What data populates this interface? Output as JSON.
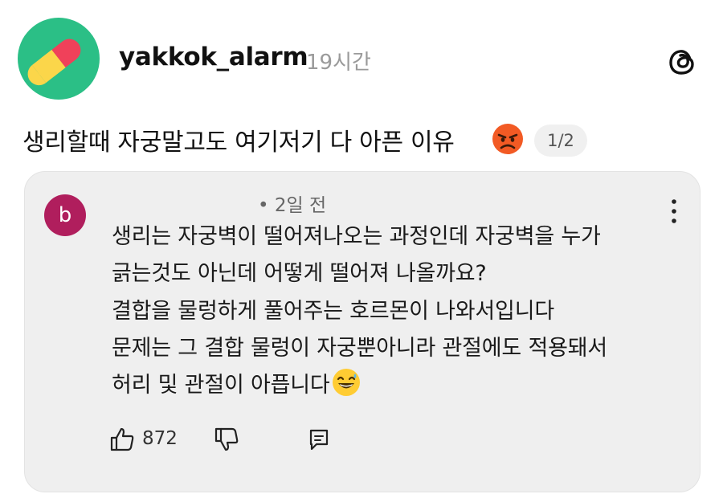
{
  "post": {
    "username": "yakkok_alarm",
    "time": "19시간",
    "caption": "생리할때 자궁말고도 여기저기 다 아픈 이유",
    "caption_emoji": "angry-face-emoji",
    "page_indicator": "1/2"
  },
  "comment": {
    "avatar_letter": "b",
    "time": "• 2일 전",
    "lines": [
      "생리는 자궁벽이 떨어져나오는 과정인데 자궁벽을 누가",
      "긁는것도 아닌데 어떻게 떨어져 나올까요?",
      "결합을 물렁하게 풀어주는 호르몬이 나와서입니다",
      "문제는 그 결합 물렁이 자궁뿐아니라 관절에도 적용돼서",
      "허리 및 관절이 아픕니다"
    ],
    "like_count": "872"
  },
  "icons": {
    "avatar": "pill-icon",
    "threads": "threads-logo-icon",
    "more": "more-vertical-icon",
    "like": "thumbs-up-icon",
    "dislike": "thumbs-down-icon",
    "reply": "reply-icon",
    "trailing_emoji": "grinning-sweat-emoji"
  },
  "colors": {
    "avatar_bg": "#2bbf86",
    "comment_avatar_bg": "#b01e5d",
    "card_bg": "#efefef",
    "muted_text": "#9a9a9a"
  }
}
